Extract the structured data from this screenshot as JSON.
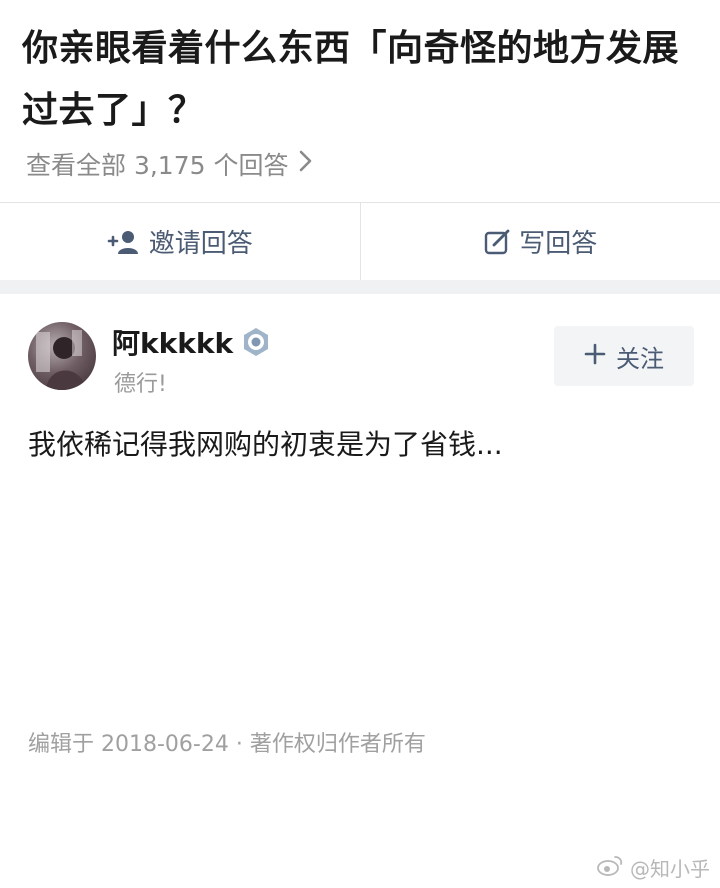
{
  "question": {
    "title": "你亲眼看着什么东西「向奇怪的地方发展过去了」？",
    "view_all_label": "查看全部 3,175 个回答",
    "view_all_icon": "chevron-right-icon"
  },
  "actions": {
    "invite_label": "邀请回答",
    "invite_icon": "add-user-icon",
    "write_label": "写回答",
    "write_icon": "edit-icon"
  },
  "answer": {
    "author_name": "阿kkkkk",
    "author_badge_icon": "verified-badge-icon",
    "author_bio": "德行!",
    "follow_label": "关注",
    "follow_icon": "plus-icon",
    "text": "我依稀记得我网购的初衷是为了省钱...",
    "meta": "编辑于 2018-06-24 · 著作权归作者所有"
  },
  "watermark": {
    "text": "@知小乎",
    "icon": "weibo-icon"
  },
  "colors": {
    "text_primary": "#1a1a1a",
    "text_secondary": "#8a8a8a",
    "action_blue_gray": "#4a5b73",
    "divider_band": "#f0f1f3",
    "follow_bg": "#f3f4f6"
  }
}
